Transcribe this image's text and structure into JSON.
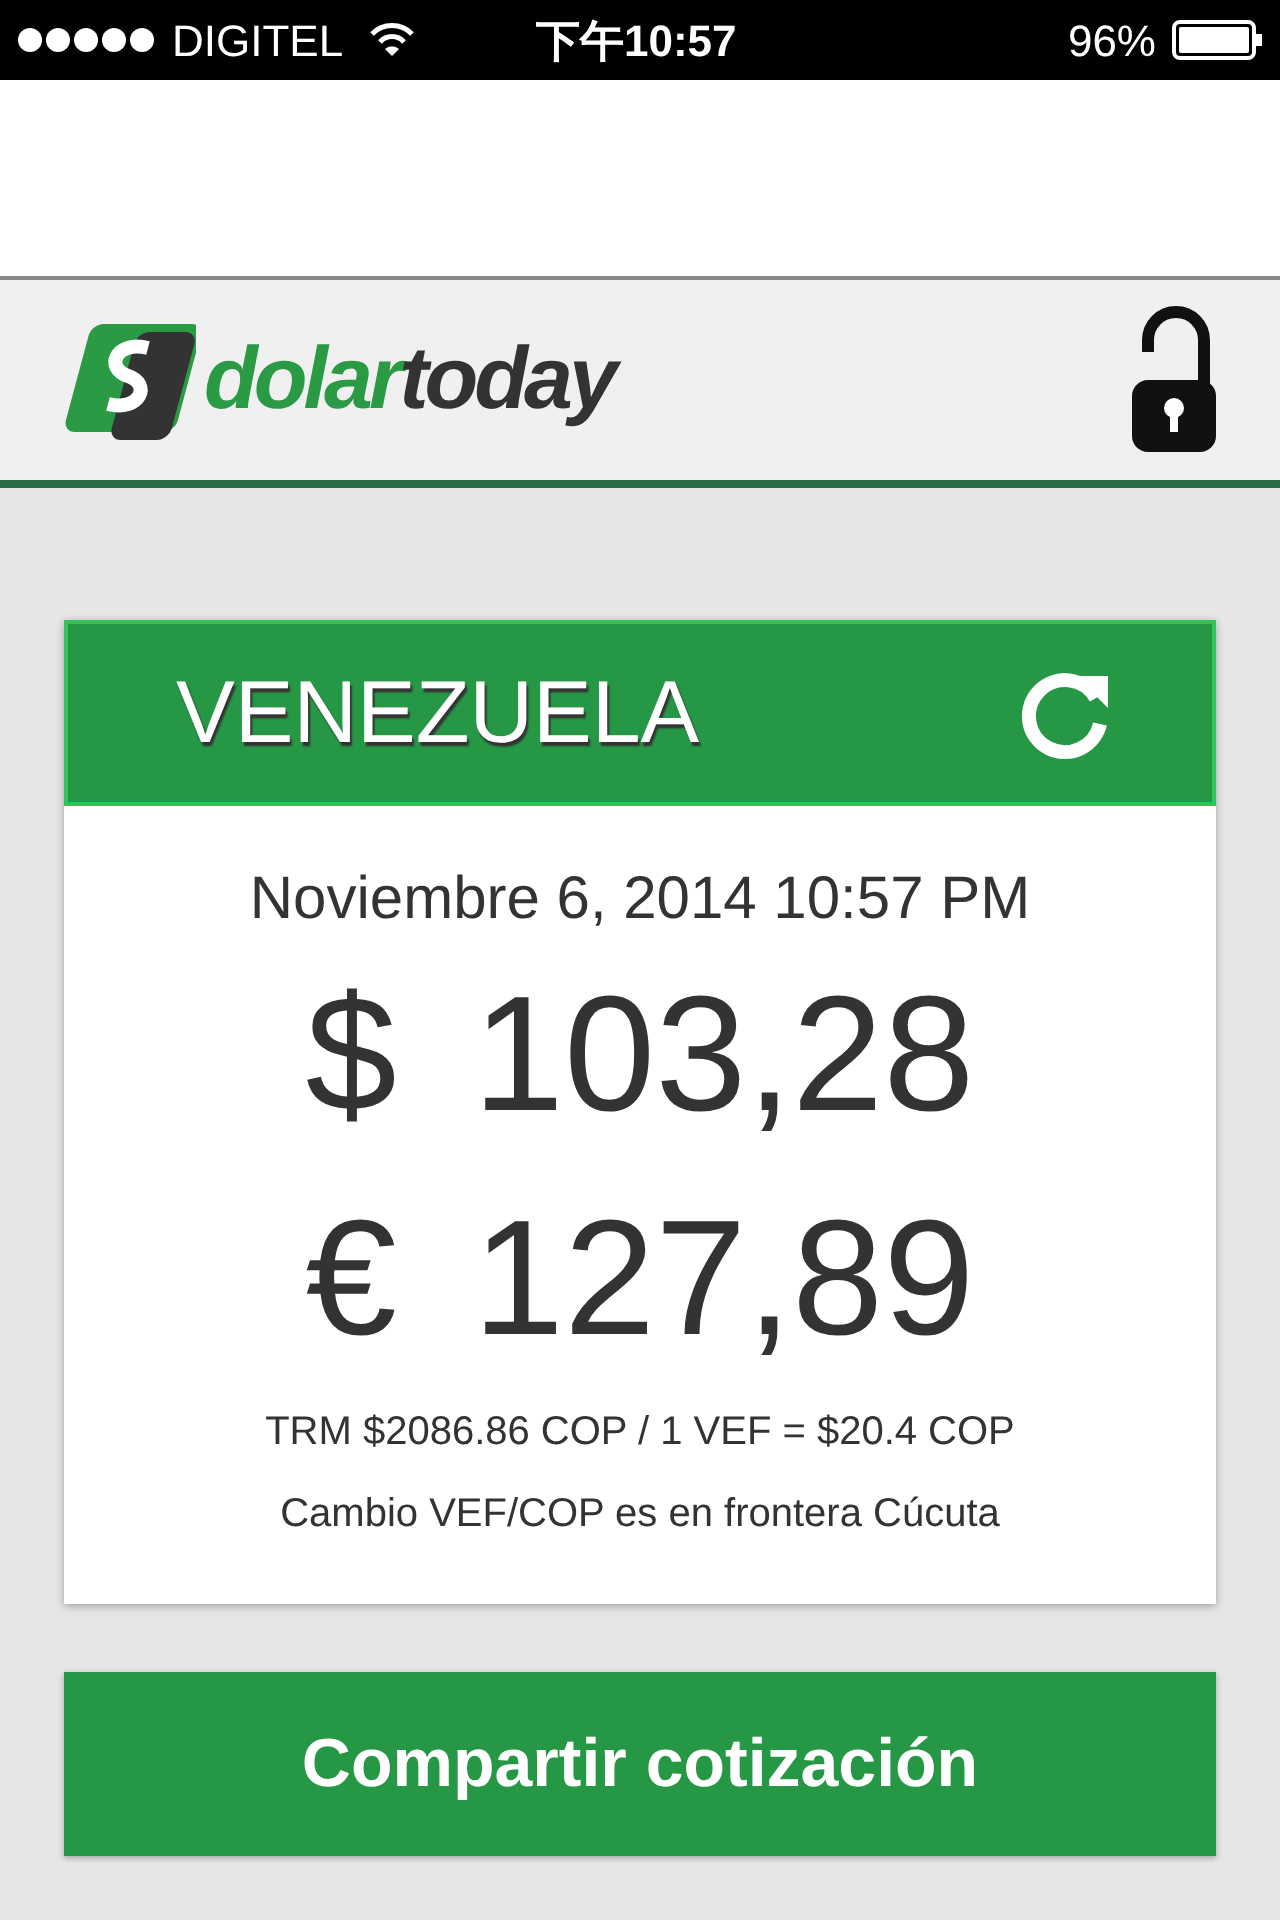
{
  "status_bar": {
    "carrier": "DIGITEL",
    "time": "下午10:57",
    "battery": "96%"
  },
  "header": {
    "logo": {
      "part_1": "dolar",
      "part_2": "today"
    },
    "locked": false
  },
  "card": {
    "title": "VENEZUELA",
    "date": "Noviembre 6, 2014 10:57 PM",
    "prices": [
      {
        "symbol": "$",
        "value": "103,28"
      },
      {
        "symbol": "€",
        "value": "127,89"
      }
    ],
    "notes": [
      "TRM $2086.86 COP / 1 VEF = $20.4 COP",
      "Cambio VEF/COP es en frontera Cúcuta"
    ]
  },
  "share_button": "Compartir cotización"
}
